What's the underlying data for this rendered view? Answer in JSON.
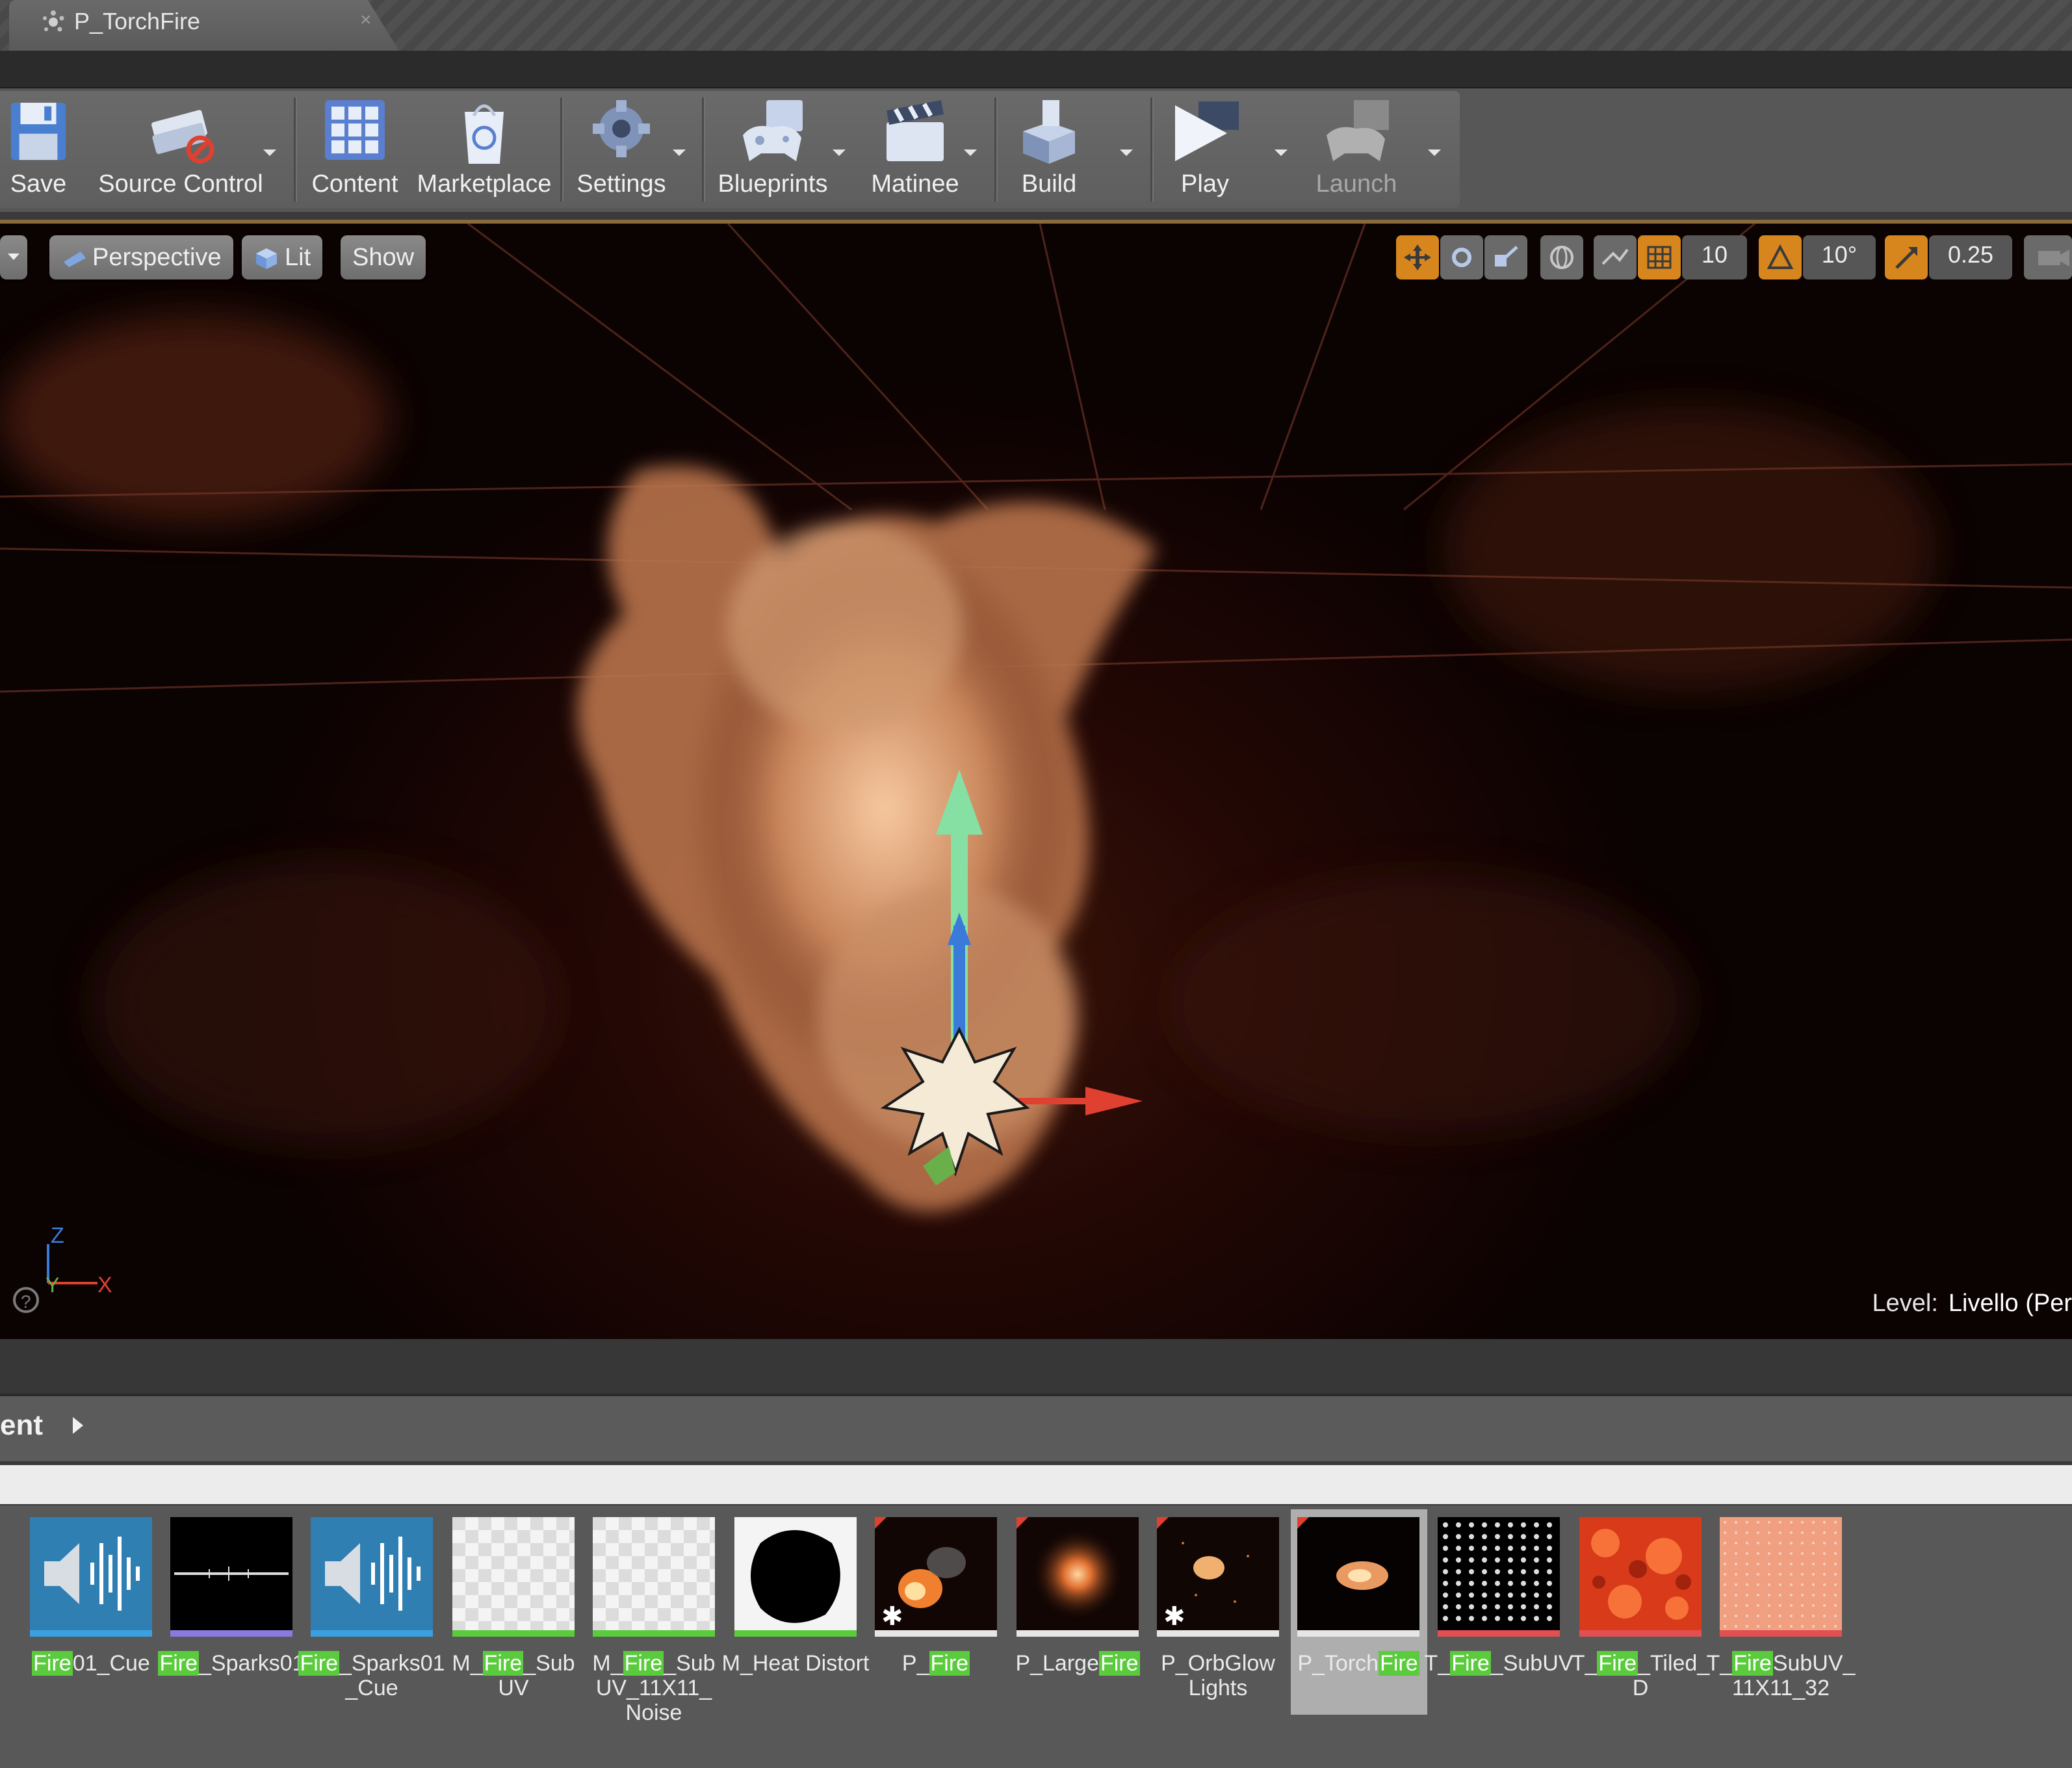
{
  "tab": {
    "title": "P_TorchFire",
    "close": "×"
  },
  "toolbar": {
    "save": "Save",
    "source_control": "Source Control",
    "content": "Content",
    "marketplace": "Marketplace",
    "settings": "Settings",
    "blueprints": "Blueprints",
    "matinee": "Matinee",
    "build": "Build",
    "play": "Play",
    "launch": "Launch"
  },
  "viewport": {
    "perspective": "Perspective",
    "lit": "Lit",
    "show": "Show",
    "grid_snap": "10",
    "rotation_snap": "10°",
    "scale_snap": "0.25",
    "axis_z": "Z",
    "axis_y": "Y",
    "axis_x": "X",
    "level_label": "Level:",
    "level_name": "Livello (Per"
  },
  "content_browser": {
    "title": "ent",
    "assets": [
      {
        "pre": "",
        "hl": "Fire",
        "post": "01_Cue",
        "type": "sound",
        "stripe": "#3aa0e0"
      },
      {
        "pre": "",
        "hl": "Fire",
        "post": "_Sparks01",
        "type": "wave",
        "stripe": "#8a7ae0"
      },
      {
        "pre": "",
        "hl": "Fire",
        "post": "_Sparks01 _Cue",
        "type": "sound",
        "stripe": "#3aa0e0"
      },
      {
        "pre": "M_",
        "hl": "Fire",
        "post": "_Sub UV",
        "type": "checker",
        "stripe": "#5acb3c"
      },
      {
        "pre": "M_",
        "hl": "Fire",
        "post": "_Sub UV_11X11_ Noise",
        "type": "checker",
        "stripe": "#5acb3c"
      },
      {
        "pre": "M_Heat Distort",
        "hl": "",
        "post": "",
        "type": "blob",
        "stripe": "#5acb3c"
      },
      {
        "pre": "P_",
        "hl": "Fire",
        "post": "",
        "type": "fire",
        "stripe": "#e6e6e6"
      },
      {
        "pre": "P_Large",
        "hl": "Fire",
        "post": "",
        "type": "glow",
        "stripe": "#e6e6e6"
      },
      {
        "pre": "P_OrbGlow Lights",
        "hl": "",
        "post": "",
        "type": "orb",
        "stripe": "#e6e6e6"
      },
      {
        "pre": "P_Torch",
        "hl": "Fire",
        "post": "",
        "type": "torch",
        "stripe": "#e6e6e6",
        "selected": true
      },
      {
        "pre": "T_",
        "hl": "Fire",
        "post": "_SubUV",
        "type": "grid",
        "stripe": "#e05050"
      },
      {
        "pre": "T_",
        "hl": "Fire",
        "post": "_Tiled_ D",
        "type": "lava",
        "stripe": "#e05050"
      },
      {
        "pre": "T_",
        "hl": "Fire",
        "post": "SubUV_ 11X11_32",
        "type": "dots",
        "stripe": "#e05050"
      }
    ]
  }
}
